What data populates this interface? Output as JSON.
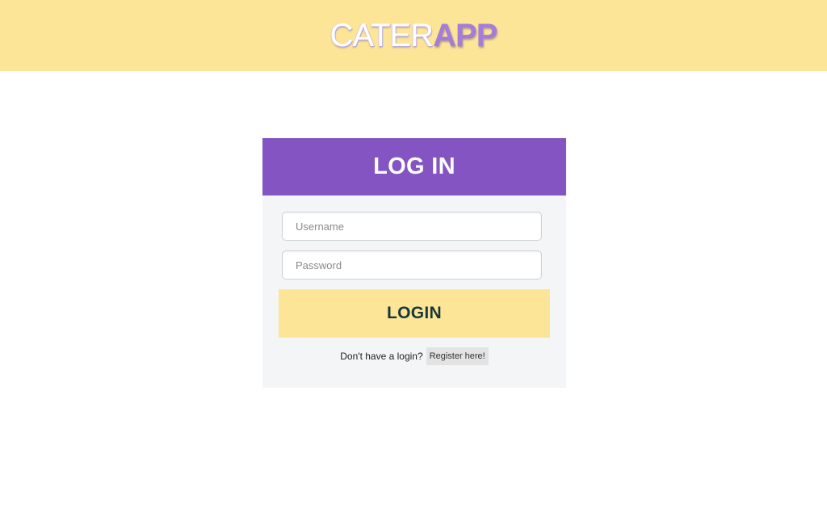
{
  "header": {
    "logo_part1": "CATER",
    "logo_part2": "APP"
  },
  "login_card": {
    "title": "LOG IN",
    "username_placeholder": "Username",
    "password_placeholder": "Password",
    "login_button": "LOGIN",
    "register_prompt": "Don't have a login?",
    "register_link": "Register here!"
  },
  "colors": {
    "header_bg": "#fde597",
    "card_header_bg": "#8354c2",
    "card_bg": "#f4f5f7",
    "login_button_bg": "#fde597",
    "login_button_text": "#16373a",
    "logo_accent": "#a37dd7"
  }
}
